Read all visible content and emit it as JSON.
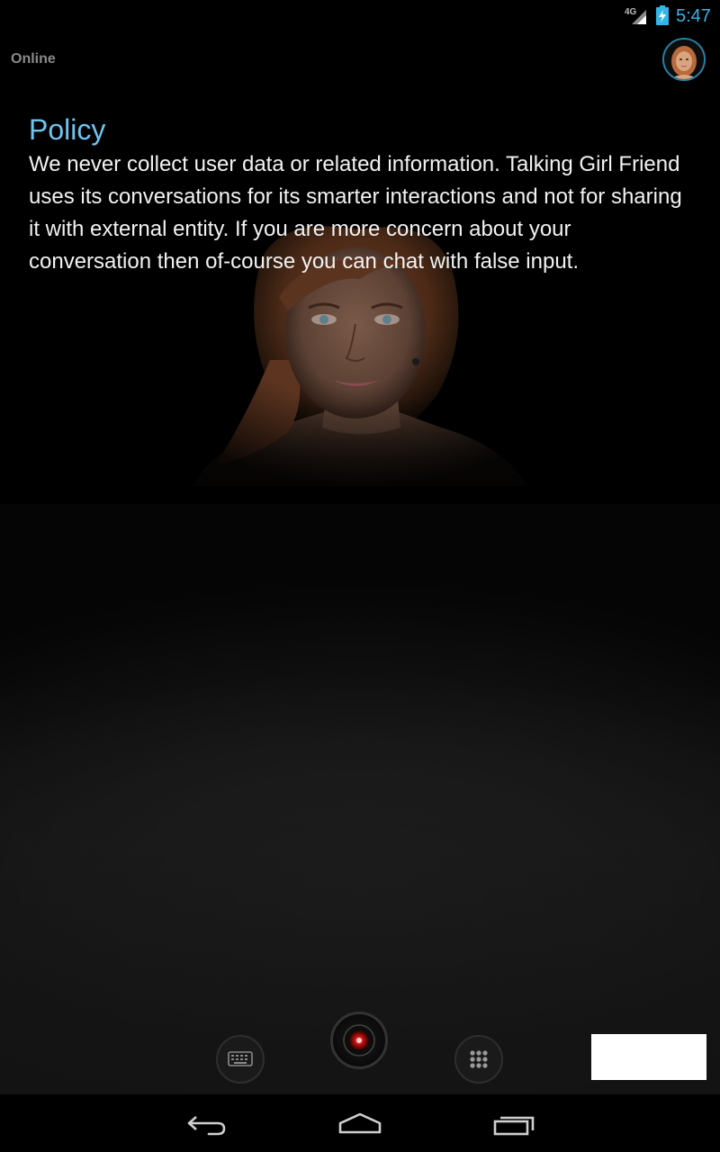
{
  "status_bar": {
    "network": "4G",
    "time": "5:47"
  },
  "header": {
    "status_label": "Online"
  },
  "policy": {
    "title": "Policy",
    "body": "We never collect user data or related information. Talking Girl Friend uses its conversations for its smarter interactions and not for sharing it with external entity. If you are more concern about your conversation then of-course you can chat with false input."
  },
  "colors": {
    "accent": "#33b5e5",
    "title": "#6ec4ee",
    "background": "#000000"
  },
  "controls": {
    "keyboard_icon": "keyboard-icon",
    "mic_icon": "record-icon",
    "menu_icon": "grid-menu-icon"
  },
  "nav_bar": {
    "back_icon": "back-icon",
    "home_icon": "home-icon",
    "recent_icon": "recent-apps-icon"
  }
}
